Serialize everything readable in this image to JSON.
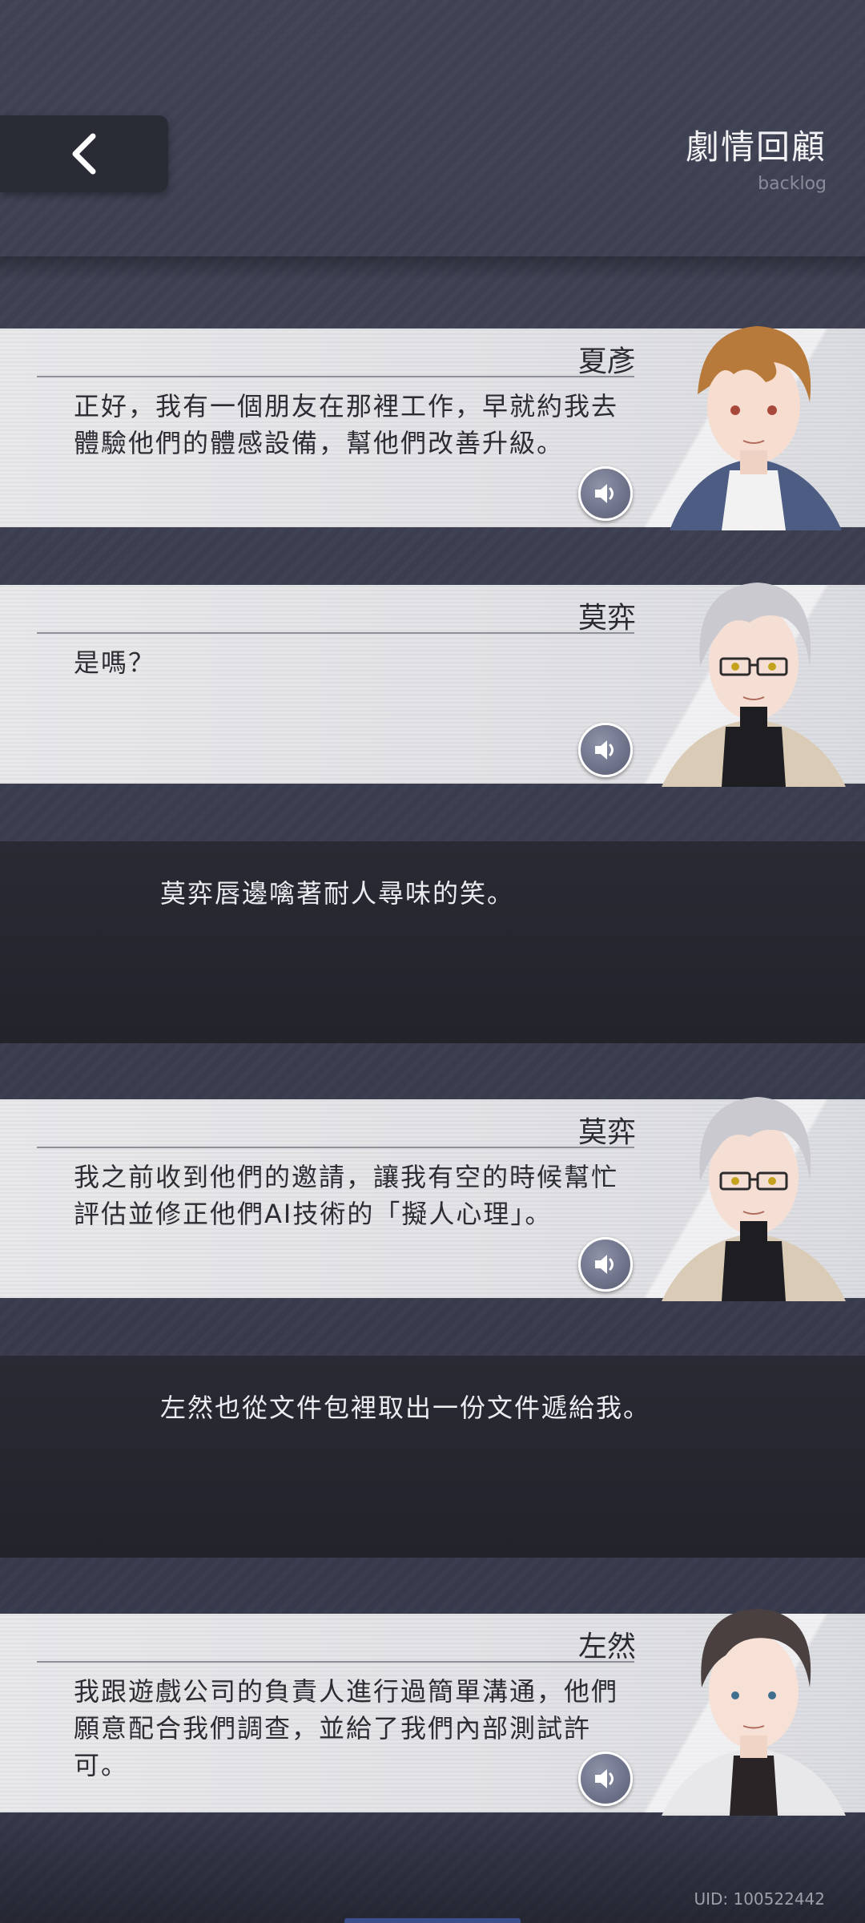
{
  "header": {
    "title": "劇情回顧",
    "subtitle": "backlog",
    "back_icon": "chevron-left-icon"
  },
  "entries": [
    {
      "type": "dialogue",
      "speaker": "夏彥",
      "text": "正好，我有一個朋友在那裡工作，早就約我去體驗他們的體感設備，幫他們改善升級。",
      "hair_color": "#b77a3a"
    },
    {
      "type": "dialogue",
      "speaker": "莫弈",
      "text": "是嗎？",
      "hair_color": "#c9c9cf"
    },
    {
      "type": "narration",
      "text": "莫弈唇邊噙著耐人尋味的笑。"
    },
    {
      "type": "dialogue",
      "speaker": "莫弈",
      "text": "我之前收到他們的邀請，讓我有空的時候幫忙評估並修正他們AI技術的「擬人心理」。",
      "hair_color": "#c9c9cf"
    },
    {
      "type": "narration",
      "text": "左然也從文件包裡取出一份文件遞給我。"
    },
    {
      "type": "dialogue",
      "speaker": "左然",
      "text": "我跟遊戲公司的負責人進行過簡單溝通，他們願意配合我們調查，並給了我們內部測試許可。",
      "hair_color": "#4a4040"
    }
  ],
  "footer": {
    "uid": "UID: 100522442"
  },
  "colors": {
    "background": "#3a3d4e",
    "card": "#e6e6ea",
    "narration": "#25262e",
    "voice_button": "#6a6f88"
  }
}
